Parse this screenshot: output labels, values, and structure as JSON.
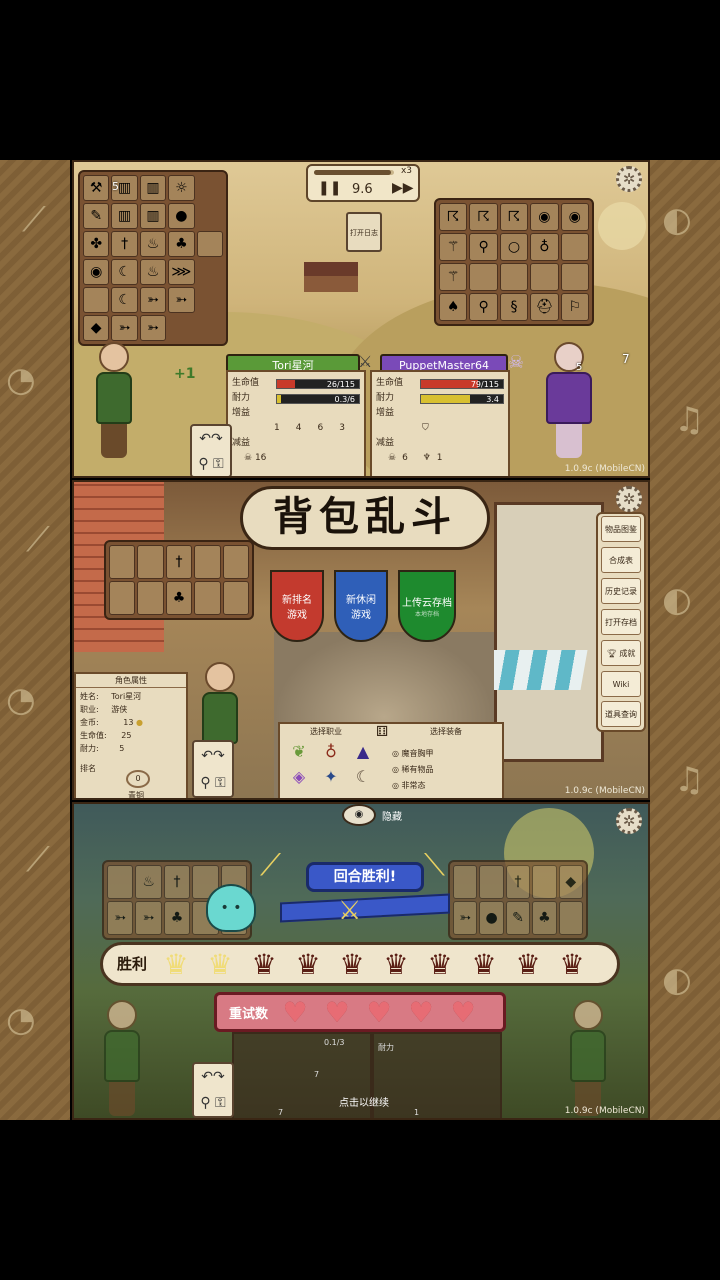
{
  "colors": {
    "sand": "#8a6a3e",
    "parchment": "#efe5cc",
    "red_banner": "#c33a2e",
    "blue_banner": "#2f5fb8",
    "green_banner": "#1e8a2e",
    "win_ribbon": "#3a58c8",
    "retry_ribbon": "#d87a84",
    "heart": "#e76c74",
    "trophy_dark": "#5a1e14",
    "trophy_gold": "#f0dc78"
  },
  "top": {
    "speed_multiplier": "x3",
    "timer": "9.6",
    "log_button": "打开日志",
    "player": {
      "name": "Tori星河",
      "level_badge": "5",
      "health_label": "生命值",
      "health": "26/115",
      "stamina_label": "耐力",
      "stamina": "0.3/6",
      "buffs_label": "增益",
      "buff_values": [
        "1",
        "4",
        "6",
        "3"
      ],
      "debuffs_label": "减益",
      "debuff_values": [
        "16"
      ],
      "bonus": "+1"
    },
    "opponent": {
      "name": "PuppetMaster64",
      "health_label": "生命值",
      "health": "79/115",
      "stamina_label": "耐力",
      "stamina": "3.4",
      "buffs_label": "增益",
      "debuffs_label": "减益",
      "debuff_values": [
        "6",
        "1"
      ],
      "level_badge": "7",
      "small_badge": "5"
    },
    "version": "1.0.9c (MobileCN)"
  },
  "middle": {
    "title": "背包乱斗",
    "modes": [
      {
        "label": "新排名\n游戏"
      },
      {
        "label": "新休闲\n游戏"
      },
      {
        "label": "上传云存档"
      }
    ],
    "upload_sub": "本地存档",
    "menu": [
      {
        "label": "物品图鉴"
      },
      {
        "label": "合成表"
      },
      {
        "label": "历史记录"
      },
      {
        "label": "打开存档"
      },
      {
        "label": "成就"
      },
      {
        "label": "Wiki"
      },
      {
        "label": "道具查询"
      }
    ],
    "stats_card": {
      "title": "角色属性",
      "rows": [
        {
          "k": "姓名:",
          "v": "Tori星河"
        },
        {
          "k": "职业:",
          "v": "游侠"
        },
        {
          "k": "金币:",
          "v": "13"
        },
        {
          "k": "生命值:",
          "v": "25"
        },
        {
          "k": "耐力:",
          "v": "5"
        }
      ],
      "rank_label": "排名",
      "rank_value": "0",
      "rank_caption": "青铜"
    },
    "class_select": {
      "title": "选择职业"
    },
    "gear_select": {
      "title": "选择装备",
      "options": [
        "魔音胸甲",
        "稀有物品",
        "非常态"
      ]
    },
    "version": "1.0.9c (MobileCN)"
  },
  "bottom": {
    "hide_label": "隐藏",
    "round_result": "回合胜利!",
    "wins_label": "胜利",
    "wins": 2,
    "total_rounds": 10,
    "retries_label": "重试数",
    "hearts": 5,
    "stamina": "0.1/3",
    "stamina_label": "耐力",
    "tap_to_continue": "点击以继续",
    "small_values": [
      "7",
      "7",
      "1"
    ],
    "version": "1.0.9c (MobileCN)"
  }
}
